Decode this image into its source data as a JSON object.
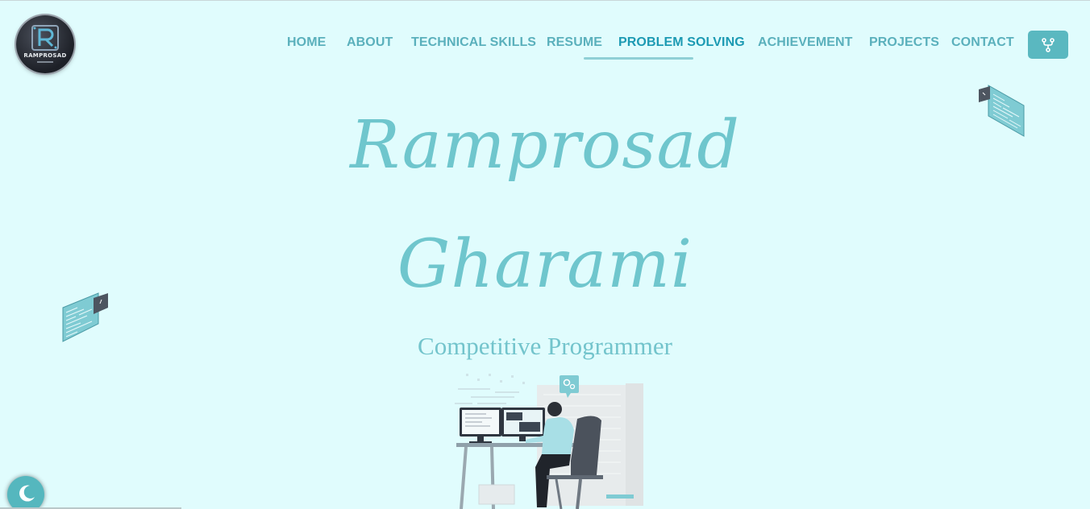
{
  "brand": {
    "logo_text": "RAMPROSAD",
    "logo_icon": "monogram-r-icon"
  },
  "nav": {
    "items": [
      {
        "label": "HOME",
        "active": false
      },
      {
        "label": "ABOUT",
        "active": false
      },
      {
        "label": "TECHNICAL SKILLS",
        "active": false
      },
      {
        "label": "RESUME",
        "active": false
      },
      {
        "label": "PROBLEM SOLVING",
        "active": true
      },
      {
        "label": "ACHIEVEMENT",
        "active": false
      },
      {
        "label": "PROJECTS",
        "active": false
      },
      {
        "label": "CONTACT",
        "active": false
      }
    ],
    "fork_icon": "git-fork-icon"
  },
  "hero": {
    "first_name": "Ramprosad",
    "last_name": "Gharami",
    "role": "Competitive Programmer"
  },
  "theme_toggle": {
    "icon": "moon-icon"
  },
  "colors": {
    "background": "#e0fcfd",
    "accent": "#5ab8c0",
    "nav_text": "#5ab0bc",
    "nav_active": "#1c9ab3",
    "hero_text": "#6fc6cd"
  }
}
